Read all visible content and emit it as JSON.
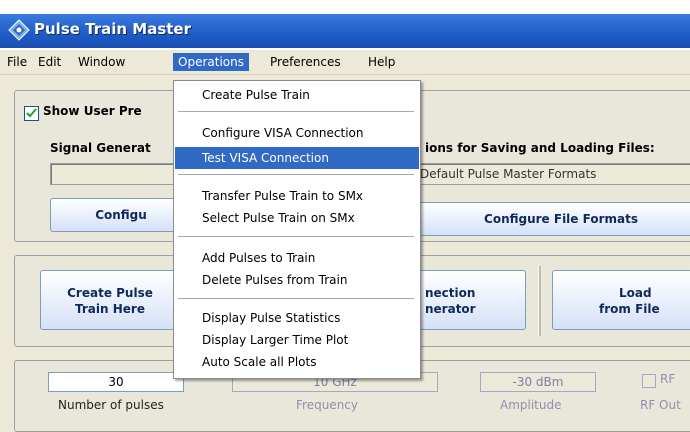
{
  "window": {
    "title": "Pulse Train Master"
  },
  "menubar": {
    "items": [
      "File",
      "Edit",
      "Window",
      "Operations",
      "Preferences",
      "Help"
    ],
    "active_index": 3
  },
  "show_user_prefs": {
    "label": "Show User Pre",
    "checked": true
  },
  "signal_generator": {
    "label": "Signal Generat",
    "configure_button": "Configu"
  },
  "file_options": {
    "label": "ions for Saving and Loading Files:",
    "format_value": "Default Pulse Master Formats",
    "configure_button": "Configure File Formats"
  },
  "actions": {
    "create_button": [
      "Create Pulse",
      "Train Here"
    ],
    "connection_label": [
      "nection",
      "nerator"
    ],
    "load_button": [
      "Load",
      "from File"
    ]
  },
  "params": {
    "num_pulses_value": "30",
    "num_pulses_label": "Number of pulses",
    "frequency_value": "10 GHz",
    "frequency_label": "Frequency",
    "amplitude_value": "-30 dBm",
    "amplitude_label": "Amplitude",
    "rf_label_top": "RF",
    "rf_label_bottom": "RF Out"
  },
  "operations_menu": {
    "items": [
      "Create Pulse Train",
      "Configure VISA Connection",
      "Test VISA Connection",
      "Transfer Pulse Train to SMx",
      "Select Pulse Train on SMx",
      "Add Pulses to Train",
      "Delete Pulses from Train",
      "Display Pulse Statistics",
      "Display Larger Time Plot",
      "Auto Scale all Plots"
    ],
    "highlighted_index": 2
  },
  "colors": {
    "title_bar": "#1f5bc6",
    "menu_highlight": "#316ac5",
    "face": "#ece9d8"
  }
}
